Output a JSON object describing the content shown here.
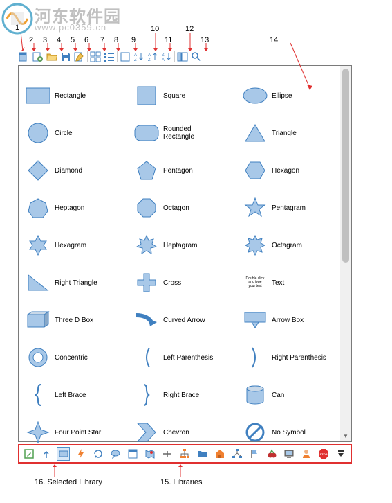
{
  "watermark": {
    "text": "河东软件园",
    "url": "www.pc0359.cn"
  },
  "callouts": {
    "top": {
      "n1": "1",
      "n2": "2",
      "n3": "3",
      "n4": "4",
      "n5": "5",
      "n6": "6",
      "n7": "7",
      "n8": "8",
      "n9": "9",
      "n10": "10",
      "n11": "11",
      "n12": "12",
      "n13": "13",
      "n14": "14"
    },
    "bot": {
      "n15": "15. Libraries",
      "n16": "16. Selected Library"
    }
  },
  "shapes": [
    {
      "name": "Rectangle"
    },
    {
      "name": "Square"
    },
    {
      "name": "Ellipse"
    },
    {
      "name": "Circle"
    },
    {
      "name": "Rounded\nRectangle"
    },
    {
      "name": "Triangle"
    },
    {
      "name": "Diamond"
    },
    {
      "name": "Pentagon"
    },
    {
      "name": "Hexagon"
    },
    {
      "name": "Heptagon"
    },
    {
      "name": "Octagon"
    },
    {
      "name": "Pentagram"
    },
    {
      "name": "Hexagram"
    },
    {
      "name": "Heptagram"
    },
    {
      "name": "Octagram"
    },
    {
      "name": "Right Triangle"
    },
    {
      "name": "Cross"
    },
    {
      "name": "Text"
    },
    {
      "name": "Three D Box"
    },
    {
      "name": "Curved Arrow"
    },
    {
      "name": "Arrow Box"
    },
    {
      "name": "Concentric"
    },
    {
      "name": "Left Parenthesis"
    },
    {
      "name": "Right Parenthesis"
    },
    {
      "name": "Left Brace"
    },
    {
      "name": "Right Brace"
    },
    {
      "name": "Can"
    },
    {
      "name": "Four Point Star"
    },
    {
      "name": "Chevron"
    },
    {
      "name": "No Symbol"
    }
  ],
  "text_preview": "Double click\nand type\nyour text",
  "colors": {
    "fill": "#a8c8e8",
    "stroke": "#4080c0",
    "toolbar": "#4080c0",
    "red": "#e03030",
    "orange": "#f08030"
  }
}
